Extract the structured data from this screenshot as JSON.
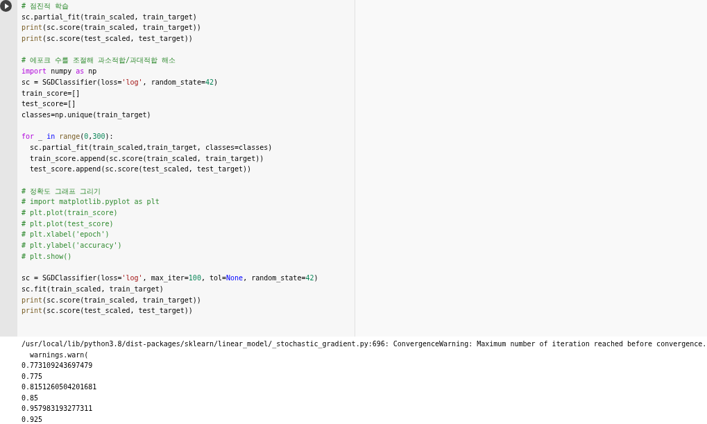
{
  "cell": {
    "code_blocks": [
      [
        [
          {
            "kind": "comment",
            "text": "# 점진적 학습"
          }
        ],
        [
          {
            "kind": "plain",
            "text": "sc.partial_fit(train_scaled, train_target)"
          }
        ],
        [
          {
            "kind": "builtin",
            "text": "print"
          },
          {
            "kind": "plain",
            "text": "(sc.score(train_scaled, train_target))"
          }
        ],
        [
          {
            "kind": "builtin",
            "text": "print"
          },
          {
            "kind": "plain",
            "text": "(sc.score(test_scaled, test_target))"
          }
        ]
      ],
      [
        [
          {
            "kind": "comment",
            "text": "# 에포크 수를 조절해 과소적합/과대적합 해소"
          }
        ],
        [
          {
            "kind": "keyword",
            "text": "import"
          },
          {
            "kind": "plain",
            "text": " numpy "
          },
          {
            "kind": "keyword",
            "text": "as"
          },
          {
            "kind": "plain",
            "text": " np"
          }
        ],
        [
          {
            "kind": "plain",
            "text": "sc = SGDClassifier(loss="
          },
          {
            "kind": "string",
            "text": "'log'"
          },
          {
            "kind": "plain",
            "text": ", random_state="
          },
          {
            "kind": "number",
            "text": "42"
          },
          {
            "kind": "plain",
            "text": ")"
          }
        ],
        [
          {
            "kind": "plain",
            "text": "train_score=[]"
          }
        ],
        [
          {
            "kind": "plain",
            "text": "test_score=[]"
          }
        ],
        [
          {
            "kind": "plain",
            "text": "classes=np.unique(train_target)"
          }
        ]
      ],
      [
        [
          {
            "kind": "keyword",
            "text": "for"
          },
          {
            "kind": "plain",
            "text": " _ "
          },
          {
            "kind": "constant",
            "text": "in"
          },
          {
            "kind": "builtin",
            "text": " range"
          },
          {
            "kind": "plain",
            "text": "("
          },
          {
            "kind": "number",
            "text": "0"
          },
          {
            "kind": "plain",
            "text": ","
          },
          {
            "kind": "number",
            "text": "300"
          },
          {
            "kind": "plain",
            "text": "):"
          }
        ],
        [
          {
            "kind": "plain",
            "text": "  sc.partial_fit(train_scaled,train_target, classes=classes)"
          }
        ],
        [
          {
            "kind": "plain",
            "text": "  train_score.append(sc.score(train_scaled, train_target))"
          }
        ],
        [
          {
            "kind": "plain",
            "text": "  test_score.append(sc.score(test_scaled, test_target))"
          }
        ]
      ],
      [
        [
          {
            "kind": "comment",
            "text": "# 정확도 그래프 그리기"
          }
        ],
        [
          {
            "kind": "comment",
            "text": "# import matplotlib.pyplot as plt"
          }
        ],
        [
          {
            "kind": "comment",
            "text": "# plt.plot(train_score)"
          }
        ],
        [
          {
            "kind": "comment",
            "text": "# plt.plot(test_score)"
          }
        ],
        [
          {
            "kind": "comment",
            "text": "# plt.xlabel('epoch')"
          }
        ],
        [
          {
            "kind": "comment",
            "text": "# plt.ylabel('accuracy')"
          }
        ],
        [
          {
            "kind": "comment",
            "text": "# plt.show()"
          }
        ]
      ],
      [
        [
          {
            "kind": "plain",
            "text": "sc = SGDClassifier(loss="
          },
          {
            "kind": "string",
            "text": "'log'"
          },
          {
            "kind": "plain",
            "text": ", max_iter="
          },
          {
            "kind": "number",
            "text": "100"
          },
          {
            "kind": "plain",
            "text": ", tol="
          },
          {
            "kind": "constant",
            "text": "None"
          },
          {
            "kind": "plain",
            "text": ", random_state="
          },
          {
            "kind": "number",
            "text": "42"
          },
          {
            "kind": "plain",
            "text": ")"
          }
        ],
        [
          {
            "kind": "plain",
            "text": "sc.fit(train_scaled, train_target)"
          }
        ],
        [
          {
            "kind": "builtin",
            "text": "print"
          },
          {
            "kind": "plain",
            "text": "(sc.score(train_scaled, train_target))"
          }
        ],
        [
          {
            "kind": "builtin",
            "text": "print"
          },
          {
            "kind": "plain",
            "text": "(sc.score(test_scaled, test_target))"
          }
        ]
      ]
    ],
    "output_lines": [
      "/usr/local/lib/python3.8/dist-packages/sklearn/linear_model/_stochastic_gradient.py:696: ConvergenceWarning: Maximum number of iteration reached before convergence.",
      "  warnings.warn(",
      "0.773109243697479",
      "0.775",
      "0.8151260504201681",
      "0.85",
      "0.957983193277311",
      "0.925"
    ]
  }
}
